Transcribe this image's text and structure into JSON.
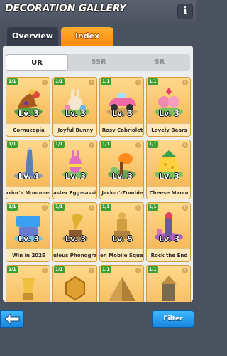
{
  "header": {
    "title": "DECORATION GALLERY",
    "info_label": "i"
  },
  "tabs": [
    {
      "label": "Overview"
    },
    {
      "label": "Index"
    }
  ],
  "rarity_tabs": [
    {
      "label": "UR"
    },
    {
      "label": "SSR"
    },
    {
      "label": "SR"
    }
  ],
  "cards": [
    {
      "badge": "1/1",
      "level": "Lv. 3",
      "name": "Cornucopia",
      "icon": "cornucopia-icon"
    },
    {
      "badge": "1/1",
      "level": "Lv. 3",
      "name": "Joyful Bunny",
      "icon": "bunny-icon"
    },
    {
      "badge": "1/1",
      "level": "Lv. 3",
      "name": "Rosy Cabriolet",
      "icon": "car-icon"
    },
    {
      "badge": "1/1",
      "level": "Lv. 3",
      "name": "Lovely Bears",
      "icon": "bears-icon"
    },
    {
      "badge": "1/1",
      "level": "Lv. 4",
      "name": "rrior's Monument",
      "icon": "monument-icon"
    },
    {
      "badge": "1/1",
      "level": "Lv. 3",
      "name": "aster Egg-sassin",
      "icon": "egg-icon"
    },
    {
      "badge": "1/1",
      "level": "Lv. 3",
      "name": "Jack-o'-Zombie",
      "icon": "pumpkin-icon"
    },
    {
      "badge": "1/1",
      "level": "Lv. 3",
      "name": "Cheese Manor",
      "icon": "cheese-icon"
    },
    {
      "badge": "1/1",
      "level": "Lv. 3",
      "name": "Win in 2025",
      "icon": "trophy-sign-icon"
    },
    {
      "badge": "1/1",
      "level": "Lv. 3",
      "name": "ulous Phonograp",
      "icon": "phonograph-icon"
    },
    {
      "badge": "1/1",
      "level": "Lv. 5",
      "name": "en Mobile Squad",
      "icon": "statue-icon"
    },
    {
      "badge": "1/1",
      "level": "Lv. 3",
      "name": "Rock the End",
      "icon": "rock-icon"
    },
    {
      "badge": "1/1",
      "level": "",
      "name": "",
      "icon": "gold-trophy-icon"
    },
    {
      "badge": "1/1",
      "level": "",
      "name": "",
      "icon": "emblem-icon"
    },
    {
      "badge": "1/1",
      "level": "",
      "name": "",
      "icon": "pyramid-icon"
    },
    {
      "badge": "1/1",
      "level": "",
      "name": "",
      "icon": "tower-icon"
    }
  ],
  "footer": {
    "filter_label": "Filter"
  },
  "colors": {
    "accent_orange": "#ff9a1f",
    "button_blue": "#1f95ec",
    "badge_green": "#3f9e30"
  }
}
